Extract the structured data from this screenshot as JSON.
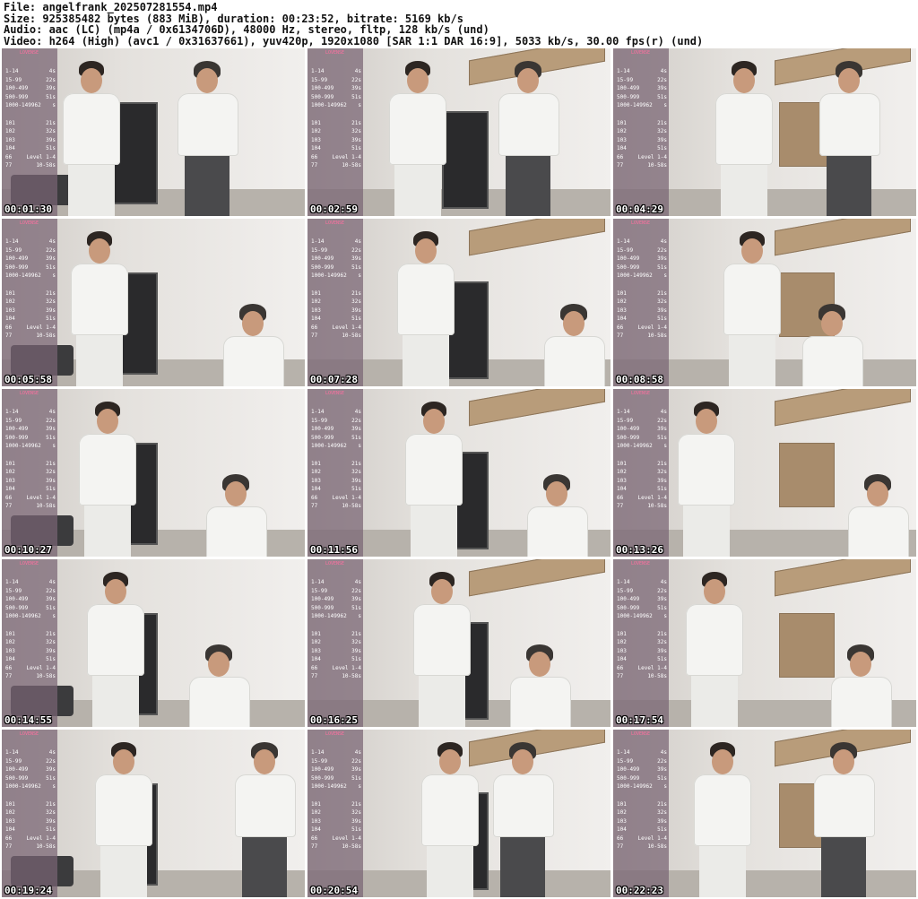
{
  "header": {
    "file": "File: angelfrank_202507281554.mp4",
    "size": "Size: 925385482 bytes (883 MiB), duration: 00:23:52, bitrate: 5169 kb/s",
    "audio": "Audio: aac (LC) (mp4a / 0x6134706D), 48000 Hz, stereo, fltp, 128 kb/s (und)",
    "video": "Video: h264 (High) (avc1 / 0x31637661), yuv420p, 1920x1080 [SAR 1:1 DAR 16:9], 5033 kb/s, 30.00 fps(r) (und)"
  },
  "overlay": {
    "brand": "LOVENSE",
    "rows": [
      {
        "range": "1-14",
        "value": "4s"
      },
      {
        "range": "15-99",
        "value": "22s"
      },
      {
        "range": "100-499",
        "value": "39s"
      },
      {
        "range": "500-999",
        "value": "51s"
      },
      {
        "range": "1000-149962",
        "value": "s"
      },
      {
        "range": "101",
        "value": "21s"
      },
      {
        "range": "102",
        "value": "32s"
      },
      {
        "range": "103",
        "value": "39s"
      },
      {
        "range": "104",
        "value": "51s"
      },
      {
        "range": "66",
        "value": "Level 1-4"
      },
      {
        "range": "77",
        "value": "10-58s"
      }
    ]
  },
  "thumbnails": [
    {
      "timestamp": "00:01:30"
    },
    {
      "timestamp": "00:02:59"
    },
    {
      "timestamp": "00:04:29"
    },
    {
      "timestamp": "00:05:58"
    },
    {
      "timestamp": "00:07:28"
    },
    {
      "timestamp": "00:08:58"
    },
    {
      "timestamp": "00:10:27"
    },
    {
      "timestamp": "00:11:56"
    },
    {
      "timestamp": "00:13:26"
    },
    {
      "timestamp": "00:14:55"
    },
    {
      "timestamp": "00:16:25"
    },
    {
      "timestamp": "00:17:54"
    },
    {
      "timestamp": "00:19:24"
    },
    {
      "timestamp": "00:20:54"
    },
    {
      "timestamp": "00:22:23"
    }
  ]
}
